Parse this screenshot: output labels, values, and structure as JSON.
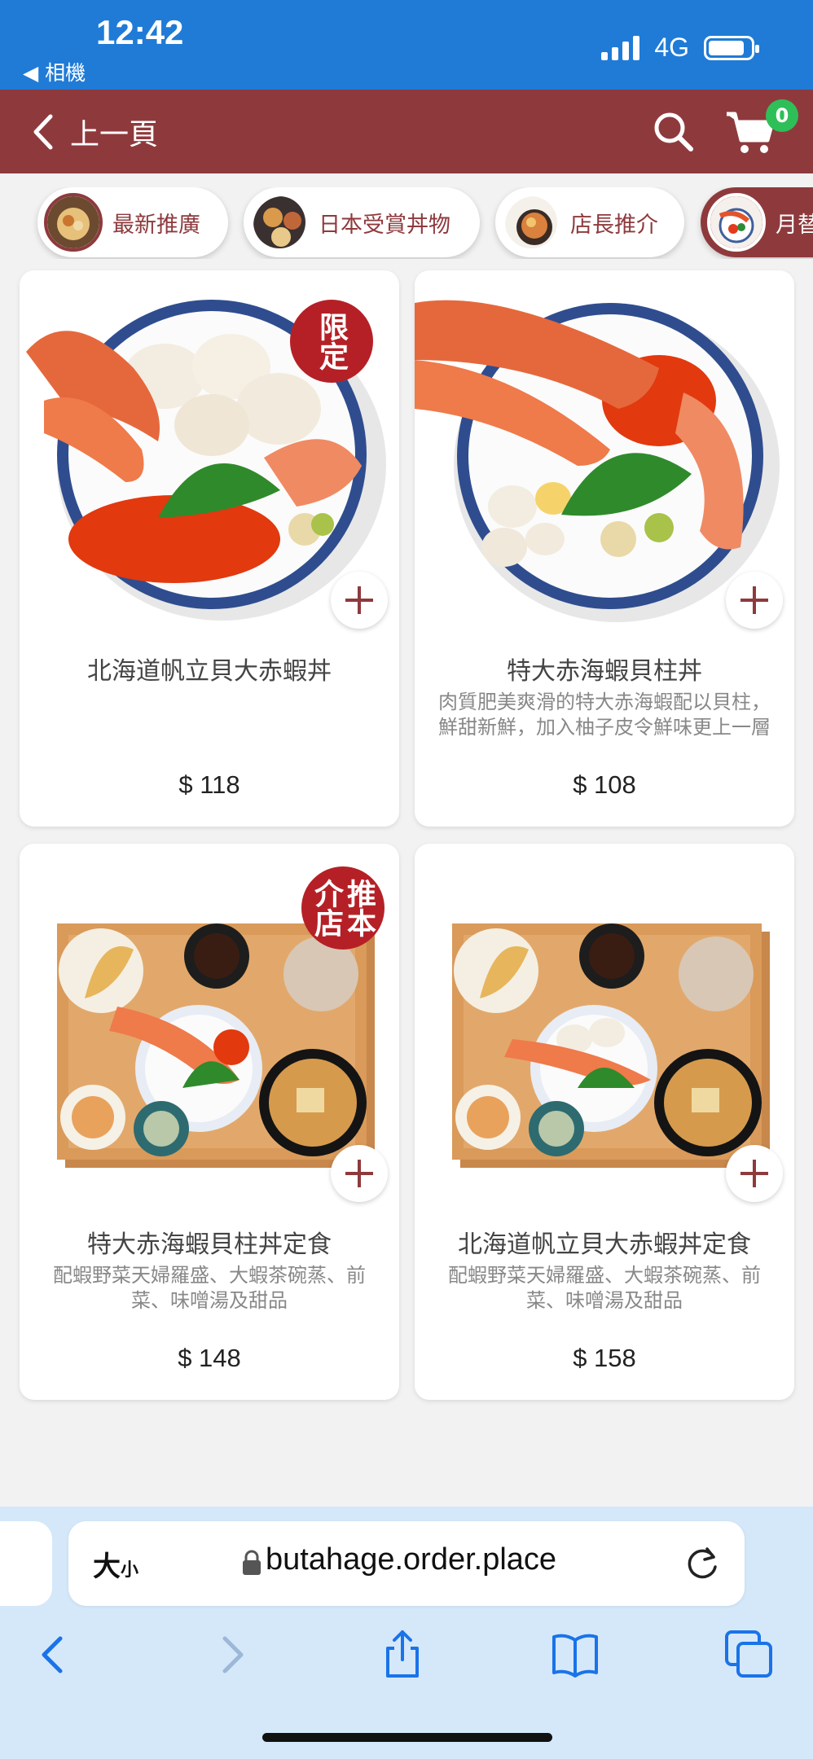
{
  "status_bar": {
    "time": "12:42",
    "back_app": "◀ 相機",
    "network": "4G",
    "battery_level": 0.85
  },
  "header": {
    "back_label": "上一頁",
    "cart_count": "0"
  },
  "categories": [
    {
      "label": "最新推廣",
      "active": false
    },
    {
      "label": "日本受賞丼物",
      "active": false
    },
    {
      "label": "店長推介",
      "active": false
    },
    {
      "label": "月替",
      "active": true
    }
  ],
  "products": [
    {
      "name": "北海道帆立貝大赤蝦丼",
      "description": "",
      "price": "$ 118",
      "badge": "限定"
    },
    {
      "name": "特大赤海蝦貝柱丼",
      "description": "肉質肥美爽滑的特大赤海蝦配以貝柱，鮮甜新鮮，加入柚子皮令鮮味更上一層",
      "price": "$ 108",
      "badge": ""
    },
    {
      "name": "特大赤海蝦貝柱丼定食",
      "description": "配蝦野菜天婦羅盛、大蝦茶碗蒸、前菜、味噌湯及甜品",
      "price": "$ 148",
      "badge": "推本介店"
    },
    {
      "name": "北海道帆立貝大赤蝦丼定食",
      "description": "配蝦野菜天婦羅盛、大蝦茶碗蒸、前菜、味噌湯及甜品",
      "price": "$ 158",
      "badge": ""
    }
  ],
  "browser": {
    "text_size_big": "大",
    "text_size_small": "小",
    "url": "butahage.order.place"
  },
  "colors": {
    "brand": "#8e3a3d",
    "status_bar": "#1f7bd6",
    "badge_green": "#2fbf58",
    "stamp_red": "#b52026"
  },
  "icons": [
    "back-chevron-icon",
    "search-icon",
    "cart-icon",
    "plus-icon",
    "lock-icon",
    "reload-icon",
    "nav-back-icon",
    "nav-forward-icon",
    "share-icon",
    "bookmarks-icon",
    "tabs-icon"
  ]
}
